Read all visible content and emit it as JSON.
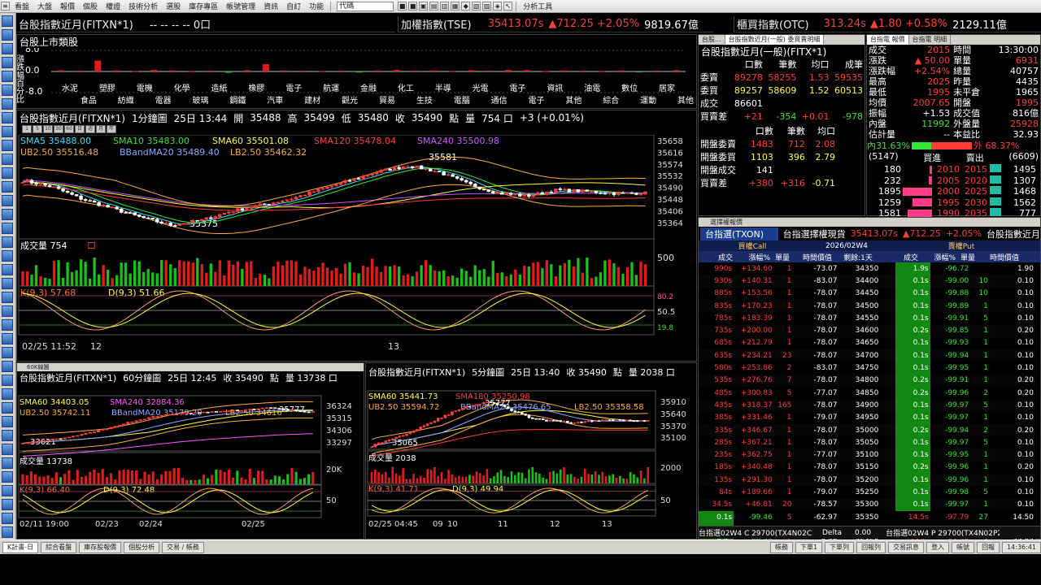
{
  "menubar": {
    "items": [
      "看盤",
      "大盤",
      "報價",
      "個股",
      "權證",
      "技術分析",
      "選股",
      "庫存專區",
      "帳號管理",
      "資訊",
      "自訂",
      "功能"
    ],
    "combo": "代碼",
    "tools_label": "分析工具"
  },
  "header": {
    "fut": {
      "name": "台股指數近月(FITXN*1)",
      "vals": "-- -- -- -- 0口"
    },
    "tse": {
      "name": "加權指數(TSE)",
      "price": "35413.07s",
      "chg": "▲712.25",
      "pct": "+2.05%",
      "amt": "9819.67億"
    },
    "otc": {
      "name": "櫃買指數(OTC)",
      "price": "313.24s",
      "chg": "▲1.80",
      "pct": "+0.58%",
      "amt": "2129.11億"
    }
  },
  "sector": {
    "title": "台股上市類股",
    "yaxis": [
      "8.0",
      "0.0",
      "-8.0"
    ],
    "ylabel": "漲跌幅百分比",
    "row1": [
      "水泥",
      "塑膠",
      "電機",
      "化學",
      "造紙",
      "橡膠",
      "電子",
      "航運",
      "金融",
      "化工",
      "半導",
      "光電",
      "電子",
      "資訊",
      "油電",
      "數位",
      "居家"
    ],
    "row2": [
      "食品",
      "紡織",
      "電器",
      "玻璃",
      "鋼鐵",
      "汽車",
      "建材",
      "觀光",
      "貿易",
      "生技",
      "電腦",
      "通信",
      "電子",
      "其他",
      "綜合",
      "運動",
      "其他"
    ],
    "values": [
      0.5,
      0.3,
      4.2,
      0.4,
      0.2,
      0.6,
      0.4,
      0.1,
      0.3,
      -0.5,
      0.5,
      2.8,
      0.4,
      0.3,
      0.2,
      0.3,
      -0.4,
      0.4,
      0.6,
      0.3,
      0.4,
      0.2,
      0.5,
      0.3,
      0.6,
      0.5,
      0.2,
      0.4,
      0.3,
      0.1,
      0.4,
      -0.2,
      0.3,
      0.5
    ]
  },
  "chart1": {
    "title": "台股指數近月(FITXN*1)",
    "period": "1分鐘圖",
    "time": "25日 13:44",
    "open_lbl": "開",
    "open": "35488",
    "high_lbl": "高",
    "high": "35499",
    "low_lbl": "低",
    "low": "35480",
    "close_lbl": "收",
    "close": "35490",
    "unit": "點",
    "vol_lbl": "量",
    "vol": "754 口",
    "chg": "+3 (+0.01%)",
    "sma5": "SMA5 35488.00",
    "sma10": "SMA10 35483.00",
    "sma60": "SMA60 35501.08",
    "sma120": "SMA120 35478.04",
    "sma240": "SMA240 35500.98",
    "ub": "UB2.50 35516.48",
    "bband": "BBandMA20 35489.40",
    "lb": "LB2.50 35462.32",
    "yaxis": [
      "35658",
      "35616",
      "35574",
      "35532",
      "35490",
      "35448",
      "35406",
      "35364"
    ],
    "hi_mark": "35581",
    "lo_mark": "35375",
    "vol_title": "成交量 754",
    "vol_unit": "口",
    "vol_axis": "500",
    "k": "K(9,3) 57.68",
    "d": "D(9,3) 51.66",
    "kd_axis": [
      "80.2",
      "50.5",
      "19.8"
    ],
    "xaxis": [
      "02/25 11:52",
      "12",
      "13"
    ]
  },
  "chart2": {
    "title": "台股指數近月(FITXN*1)",
    "period": "60分鐘圖",
    "time": "25日 12:45",
    "close": "收 35490",
    "unit": "點",
    "vol": "量 13738 口",
    "tab": "60K線圖",
    "sma60": "SMA60 34403.05",
    "sma240": "SMA240 32884.36",
    "ub": "UB2.50 35742.11",
    "bband": "BBandMA20 35179.20",
    "lb": "LB2.50 34616",
    "yaxis": [
      "36324",
      "35315",
      "34306",
      "33297"
    ],
    "hi_mark": "35777",
    "lo_mark": "33621",
    "vol_title": "成交量 13738",
    "vol_axis": "20K",
    "k": "K(9,3) 66.40",
    "d": "D(9,3) 72.48",
    "kd_axis": "50",
    "xaxis": [
      "02/11 19:00",
      "02/23",
      "02/24",
      "02/25"
    ]
  },
  "chart3": {
    "title": "台股指數近月(FITXN*1)",
    "period": "5分鐘圖",
    "time": "25日 13:40",
    "close": "收 35490",
    "unit": "點",
    "vol": "量 2038 口",
    "sma60": "SMA60 35441.73",
    "sma180": "SMA180 35250.98",
    "ub": "UB2.50 35594.72",
    "bband": "BBandMA20 35476.65",
    "lb": "LB2.50 35358.58",
    "yaxis": [
      "35910",
      "35640",
      "35370",
      "35100"
    ],
    "hi_mark": "35777",
    "lo_mark": "35065",
    "vol_title": "成交量 2038",
    "vol_axis": "2000",
    "k": "K(9,3) 41.71",
    "d": "D(9,3) 49.94",
    "kd_axis": "50",
    "xaxis": [
      "02/25 04:45",
      "09",
      "10",
      "11",
      "12",
      "13"
    ]
  },
  "quote_left": {
    "tabs": [
      "台股...",
      "台股指數近月(一般) 委買賣明細"
    ],
    "title": "台股指數近月(一般)(FITX*1)",
    "head": [
      "口數",
      "筆數",
      "均口",
      "成筆"
    ],
    "rows": [
      [
        "委賣",
        "89278",
        "58255",
        "1.53",
        "59535"
      ],
      [
        "委買",
        "89257",
        "58609",
        "1.52",
        "60513"
      ],
      [
        "成交",
        "86601",
        "",
        "",
        ""
      ],
      [
        "買賣差",
        "+21",
        "-354",
        "+0.01",
        "-978"
      ]
    ],
    "head2": [
      "口數",
      "筆數",
      "均口"
    ],
    "rows2": [
      [
        "開盤委賣",
        "1483",
        "712",
        "2.08"
      ],
      [
        "開盤委買",
        "1103",
        "396",
        "2.79"
      ],
      [
        "開盤成交",
        "141",
        "",
        ""
      ],
      [
        "買賣差",
        "+380",
        "+316",
        "-0.71"
      ]
    ]
  },
  "quote_right": {
    "tabs": [
      "台指電 報價",
      "台指電 明細"
    ],
    "rows": [
      [
        "成交",
        "2015",
        "時間",
        "13:30:00"
      ],
      [
        "漲跌",
        "▲ 50.00",
        "單量",
        "6931"
      ],
      [
        "漲跌幅",
        "+2.54%",
        "總量",
        "40757"
      ],
      [
        "最高",
        "2025",
        "昨量",
        "4435"
      ],
      [
        "最低",
        "1995",
        "未平倉",
        "1965"
      ],
      [
        "均價",
        "2007.65",
        "開盤",
        "1995"
      ],
      [
        "振幅",
        "+1.53",
        "成交值",
        "816億"
      ],
      [
        "內盤",
        "11992",
        "外盤量",
        "25928"
      ],
      [
        "估計量",
        "--",
        "本益比",
        "32.93"
      ]
    ],
    "inner_pct": "內31.63%",
    "outer_pct": "外 68.37%",
    "bid_count": "(5147)",
    "bid_lbl": "買進",
    "ask_lbl": "賣出",
    "ask_count": "(6609)",
    "book": [
      [
        "180",
        "2010",
        "2015",
        "1495"
      ],
      [
        "232",
        "2005",
        "2020",
        "1307"
      ],
      [
        "1895",
        "2000",
        "2025",
        "1468"
      ],
      [
        "1259",
        "1995",
        "2030",
        "1562"
      ],
      [
        "1581",
        "1990",
        "2035",
        "777"
      ]
    ]
  },
  "options": {
    "tab": "選擇權報價",
    "name": "台指選(TXON)",
    "subtitle": "台指選擇權現貨",
    "idx": "35413.07s",
    "chg": "▲712.25",
    "pct": "+2.05%",
    "extra": "台股指數近月",
    "call_lbl": "買權Call",
    "expiry": "2026/02W4",
    "put_lbl": "賣權Put",
    "remain": "剩餘:1天",
    "cols": [
      "成交",
      "漲幅%",
      "單量",
      "時間價值",
      "履約價",
      "成交",
      "漲幅%",
      "單量",
      "時間價值"
    ],
    "rows": [
      [
        "990s",
        "+134.60",
        "1",
        "-73.07",
        "34350",
        "1.9s",
        "-96.72",
        "",
        "1.90"
      ],
      [
        "930s",
        "+140.31",
        "1",
        "-83.07",
        "34400",
        "0.1s",
        "-99.00",
        "10",
        "0.10"
      ],
      [
        "885s",
        "+153.56",
        "1",
        "-78.07",
        "34450",
        "0.1s",
        "-99.88",
        "10",
        "0.10"
      ],
      [
        "835s",
        "+170.23",
        "1",
        "-78.07",
        "34500",
        "0.1s",
        "-99.89",
        "1",
        "0.10"
      ],
      [
        "785s",
        "+183.39",
        "1",
        "-78.07",
        "34550",
        "0.1s",
        "-99.91",
        "5",
        "0.10"
      ],
      [
        "735s",
        "+200.00",
        "1",
        "-78.07",
        "34600",
        "0.2s",
        "-99.85",
        "1",
        "0.20"
      ],
      [
        "685s",
        "+212.79",
        "1",
        "-78.07",
        "34650",
        "0.1s",
        "-99.93",
        "1",
        "0.10"
      ],
      [
        "635s",
        "+234.21",
        "23",
        "-78.07",
        "34700",
        "0.1s",
        "-99.94",
        "1",
        "0.10"
      ],
      [
        "580s",
        "+253.86",
        "2",
        "-83.07",
        "34750",
        "0.1s",
        "-99.95",
        "1",
        "0.10"
      ],
      [
        "535s",
        "+276.76",
        "7",
        "-78.07",
        "34800",
        "0.2s",
        "-99.91",
        "1",
        "0.20"
      ],
      [
        "485s",
        "+300.83",
        "5",
        "-77.07",
        "34850",
        "0.2s",
        "-99.96",
        "2",
        "0.20"
      ],
      [
        "435s",
        "+318.37",
        "165",
        "-78.07",
        "34900",
        "0.1s",
        "-99.97",
        "5",
        "0.10"
      ],
      [
        "385s",
        "+331.46",
        "1",
        "-79.07",
        "34950",
        "0.1s",
        "-99.97",
        "1",
        "0.10"
      ],
      [
        "335s",
        "+346.67",
        "1",
        "-78.07",
        "35000",
        "0.2s",
        "-99.94",
        "2",
        "0.20"
      ],
      [
        "285s",
        "+367.21",
        "1",
        "-78.07",
        "35050",
        "0.1s",
        "-99.97",
        "5",
        "0.10"
      ],
      [
        "235s",
        "+362.75",
        "1",
        "-77.07",
        "35100",
        "0.1s",
        "-99.95",
        "1",
        "0.10"
      ],
      [
        "185s",
        "+340.48",
        "1",
        "-78.07",
        "35150",
        "0.2s",
        "-99.96",
        "1",
        "0.20"
      ],
      [
        "135s",
        "+291.30",
        "1",
        "-78.07",
        "35200",
        "0.1s",
        "-99.96",
        "1",
        "0.10"
      ],
      [
        "84s",
        "+189.66",
        "1",
        "-79.07",
        "35250",
        "0.1s",
        "-99.98",
        "5",
        "0.10"
      ],
      [
        "34.5s",
        "+46.81",
        "20",
        "-78.57",
        "35300",
        "0.1s",
        "-99.97",
        "1",
        "0.10"
      ],
      [
        "0.1s",
        "-99.46",
        "5",
        "-62.97",
        "35350",
        "14.5s",
        "-97.79",
        "27",
        "14.50"
      ],
      [
        "0.1s",
        "-99.33",
        "1",
        "-12.97",
        "35400",
        "65s",
        "-90.71",
        "20",
        "65.00"
      ],
      [
        "0.2s",
        "-98.33",
        "1",
        "0.20",
        "35450",
        "114s",
        "-84.70",
        "4",
        "77.07"
      ],
      [
        "0.3s",
        "-96.88",
        "1",
        "0.30",
        "35500",
        "165s",
        "-79.25",
        "1",
        "78.07"
      ]
    ],
    "foot1": "台指選02W4 C 29700(TX4N02C29700)",
    "delta_lbl": "Delta",
    "delta": "0.00",
    "foot2": "台指選02W4 P 29700(TX4N02P29700)"
  },
  "bottom": {
    "tabs": [
      "K計畫-日",
      "綜合看盤",
      "庫存股報價",
      "個股分析",
      "交易 / 帳務"
    ],
    "buttons": [
      "帳務",
      "下單1",
      "下單列",
      "回報列",
      "交易訊息",
      "登入",
      "帳號",
      "回報",
      "14:36:41"
    ]
  },
  "colors": {
    "up": "#ff3b3b",
    "down": "#33e633",
    "bg": "#000000",
    "accent": "#2a4a9a"
  }
}
